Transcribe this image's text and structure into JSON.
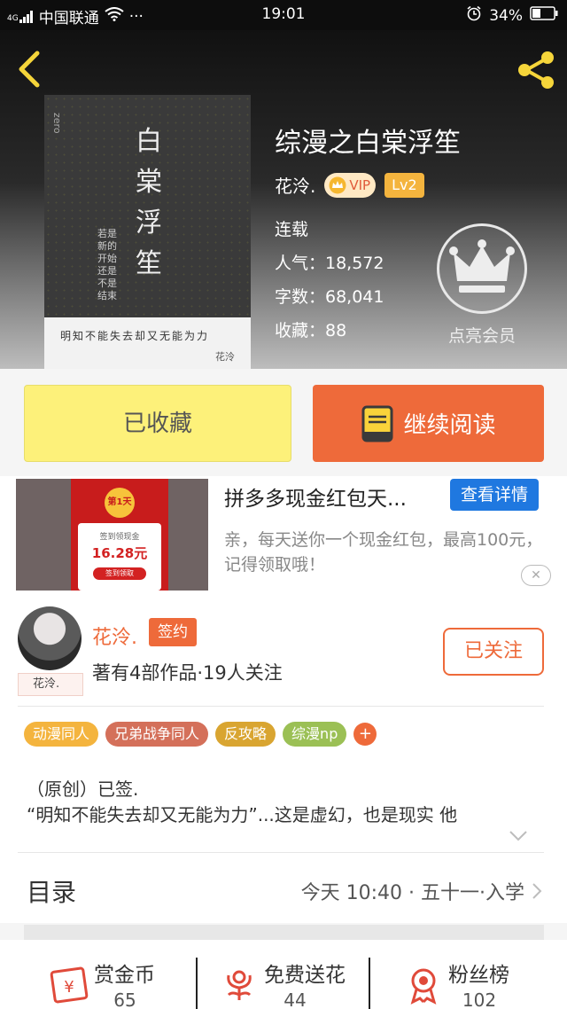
{
  "status_bar": {
    "signal": "4G",
    "carrier": "中国联通",
    "dots": "···",
    "time": "19:01",
    "battery": "34%"
  },
  "book": {
    "title": "综漫之白棠浮笙",
    "author": "花泠.",
    "vip": "VIP",
    "level": "Lv2",
    "status": "连载",
    "popularity": "人气：18,572",
    "words": "字数：68,041",
    "favorites": "收藏：88"
  },
  "cover": {
    "title_chars": "白棠浮笙",
    "side_text": "若是新的开始 还是不是结束",
    "bottom_line": "明知不能失去却又无能为力",
    "signature": "花泠",
    "top_text": "zero"
  },
  "member": {
    "label": "点亮会员"
  },
  "actions": {
    "collected_label": "已收藏",
    "continue_label": "继续阅读"
  },
  "ad": {
    "title": "拼多多现金红包天...",
    "button": "查看详情",
    "desc": "亲，每天送你一个现金红包，最高100元，记得领取哦！",
    "img_day": "第1天",
    "img_amount": "16.28元",
    "img_caption": "签到领现金",
    "img_btn": "签到领取",
    "close": "✕"
  },
  "author": {
    "name": "花泠.",
    "sign_label": "签约",
    "info": "著有4部作品·19人关注",
    "follow_label": "已关注",
    "avatar_tag": "花泠."
  },
  "tags": [
    {
      "label": "动漫同人",
      "color": "#f4b43e"
    },
    {
      "label": "兄弟战争同人",
      "color": "#d4705a"
    },
    {
      "label": "反攻略",
      "color": "#d9a531"
    },
    {
      "label": "综漫np",
      "color": "#9bc055"
    }
  ],
  "intro": {
    "line1": "（原创）已签.",
    "line2": "“明知不能失去却又无能为力”...这是虚幻，也是现实 他"
  },
  "toc": {
    "title": "目录",
    "latest": "今天 10:40 · 五十一·入学"
  },
  "bottom": [
    {
      "label": "赏金币",
      "count": "65"
    },
    {
      "label": "免费送花",
      "count": "44"
    },
    {
      "label": "粉丝榜",
      "count": "102"
    }
  ],
  "colors": {
    "accent": "#ee6a3a",
    "collect_bg": "#fdf17a",
    "ad_button": "#1f78e0"
  }
}
